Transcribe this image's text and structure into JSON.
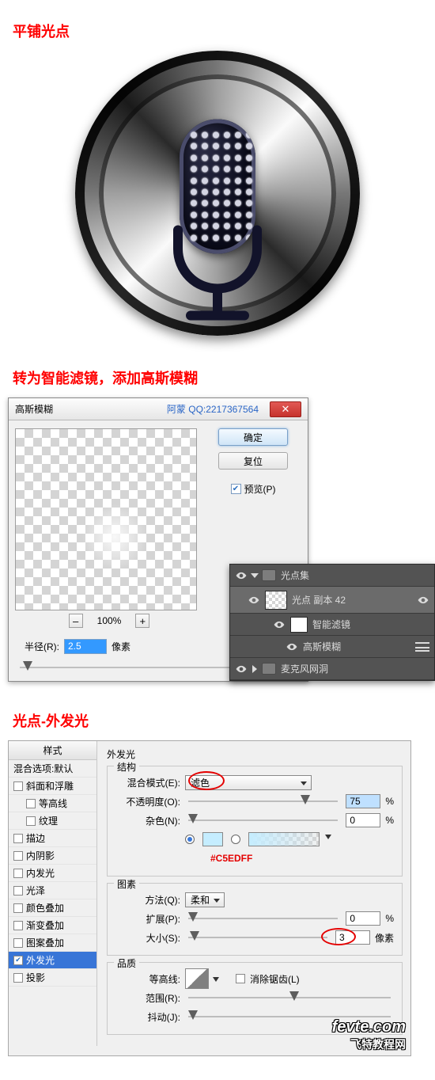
{
  "section1": {
    "title": "平铺光点"
  },
  "section2": {
    "title": "转为智能滤镜，添加高斯模糊",
    "dialog": {
      "title": "高斯模糊",
      "watermark": "阿蒙  QQ:2217367564",
      "ok": "确定",
      "reset": "复位",
      "preview_label": "预览(P)",
      "preview_checked": true,
      "zoom_minus": "–",
      "zoom_value": "100%",
      "zoom_plus": "+",
      "radius_label": "半径(R):",
      "radius_value": "2.5",
      "radius_unit": "像素"
    },
    "layers": {
      "group": "光点集",
      "layer": "光点 副本 42",
      "smart_filters_label": "智能滤镜",
      "filter_name": "高斯模糊",
      "group2": "麦克风网洞"
    }
  },
  "section3": {
    "title": "光点-外发光",
    "styles_header": "样式",
    "blend_defaults": "混合选项:默认",
    "styles": [
      {
        "label": "斜面和浮雕",
        "checked": false,
        "indent": 0
      },
      {
        "label": "等高线",
        "checked": false,
        "indent": 1
      },
      {
        "label": "纹理",
        "checked": false,
        "indent": 1
      },
      {
        "label": "描边",
        "checked": false,
        "indent": 0
      },
      {
        "label": "内阴影",
        "checked": false,
        "indent": 0
      },
      {
        "label": "内发光",
        "checked": false,
        "indent": 0
      },
      {
        "label": "光泽",
        "checked": false,
        "indent": 0
      },
      {
        "label": "颜色叠加",
        "checked": false,
        "indent": 0
      },
      {
        "label": "渐变叠加",
        "checked": false,
        "indent": 0
      },
      {
        "label": "图案叠加",
        "checked": false,
        "indent": 0
      },
      {
        "label": "外发光",
        "checked": true,
        "indent": 0,
        "selected": true
      },
      {
        "label": "投影",
        "checked": false,
        "indent": 0
      }
    ],
    "panel_title": "外发光",
    "structure": {
      "legend": "结构",
      "blend_mode_label": "混合模式(E):",
      "blend_mode_value": "滤色",
      "opacity_label": "不透明度(O):",
      "opacity_value": "75",
      "noise_label": "杂色(N):",
      "noise_value": "0",
      "color_hex": "#C5EDFF",
      "pct": "%"
    },
    "elements": {
      "legend": "图素",
      "method_label": "方法(Q):",
      "method_value": "柔和",
      "spread_label": "扩展(P):",
      "spread_value": "0",
      "size_label": "大小(S):",
      "size_value": "3",
      "size_unit": "像素",
      "pct": "%"
    },
    "quality": {
      "legend": "品质",
      "contour_label": "等高线:",
      "antialias_label": "消除锯齿(L)",
      "range_label": "范围(R):",
      "jitter_label": "抖动(J):"
    }
  },
  "watermark": {
    "line1": "fevte.com",
    "line2": "飞特教程网"
  }
}
